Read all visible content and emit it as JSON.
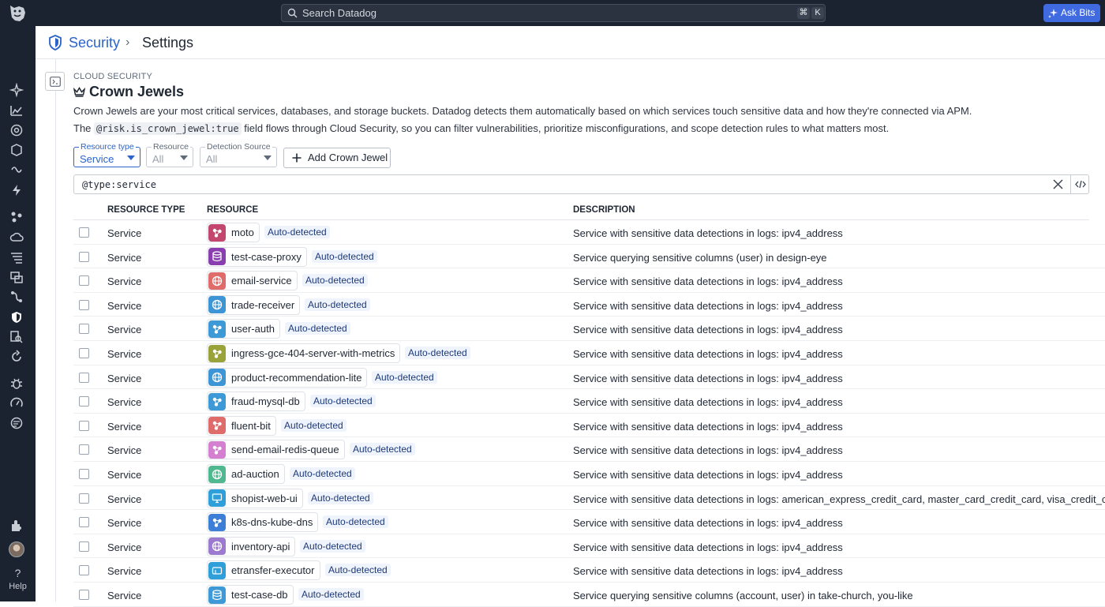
{
  "topbar": {
    "search_placeholder": "Search Datadog",
    "shortcut_cmd": "⌘",
    "shortcut_key": "K",
    "ask_bits_label": "Ask Bits"
  },
  "sidenav": {
    "help_label": "Help"
  },
  "breadcrumb": {
    "parent": "Security",
    "separator": "›",
    "current": "Settings"
  },
  "page": {
    "eyebrow": "CLOUD SECURITY",
    "title": "Crown Jewels",
    "desc_line1": "Crown Jewels are your most critical services, databases, and storage buckets. Datadog detects them automatically based on which services touch sensitive data and how they're connected via APM.",
    "desc_line2_prefix": "The",
    "desc_line2_code": "@risk.is_crown_jewel:true",
    "desc_line2_suffix": "field flows through Cloud Security, so you can filter vulnerabilities, prioritize misconfigurations, and scope detection rules to what matters most."
  },
  "filters": {
    "resource_type": {
      "label": "Resource type",
      "value": "Service"
    },
    "resource": {
      "label": "Resource",
      "value": "All"
    },
    "detection_source": {
      "label": "Detection Source",
      "value": "All"
    },
    "add_button": "Add Crown Jewel"
  },
  "query": {
    "key": "@type",
    "colon": ":",
    "value": "service"
  },
  "table": {
    "headers": {
      "type": "RESOURCE TYPE",
      "resource": "RESOURCE",
      "description": "DESCRIPTION"
    },
    "rows": [
      {
        "type": "Service",
        "name": "moto",
        "badge": "Auto-detected",
        "icon": "service-icon",
        "color": "#c2466e",
        "desc": "Service with sensitive data detections in logs: ipv4_address"
      },
      {
        "type": "Service",
        "name": "test-case-proxy",
        "badge": "Auto-detected",
        "icon": "database-icon",
        "color": "#8a3fb0",
        "desc": "Service querying sensitive columns (user) in design-eye"
      },
      {
        "type": "Service",
        "name": "email-service",
        "badge": "Auto-detected",
        "icon": "globe-icon",
        "color": "#e06b6b",
        "desc": "Service with sensitive data detections in logs: ipv4_address"
      },
      {
        "type": "Service",
        "name": "trade-receiver",
        "badge": "Auto-detected",
        "icon": "globe-icon",
        "color": "#3d95d6",
        "desc": "Service with sensitive data detections in logs: ipv4_address"
      },
      {
        "type": "Service",
        "name": "user-auth",
        "badge": "Auto-detected",
        "icon": "service-icon",
        "color": "#3d9ad6",
        "desc": "Service with sensitive data detections in logs: ipv4_address"
      },
      {
        "type": "Service",
        "name": "ingress-gce-404-server-with-metrics",
        "badge": "Auto-detected",
        "icon": "service-icon",
        "color": "#9aa33a",
        "desc": "Service with sensitive data detections in logs: ipv4_address"
      },
      {
        "type": "Service",
        "name": "product-recommendation-lite",
        "badge": "Auto-detected",
        "icon": "globe-icon",
        "color": "#3d95d6",
        "desc": "Service with sensitive data detections in logs: ipv4_address"
      },
      {
        "type": "Service",
        "name": "fraud-mysql-db",
        "badge": "Auto-detected",
        "icon": "service-icon",
        "color": "#3d9ad6",
        "desc": "Service with sensitive data detections in logs: ipv4_address"
      },
      {
        "type": "Service",
        "name": "fluent-bit",
        "badge": "Auto-detected",
        "icon": "service-icon",
        "color": "#e06b6b",
        "desc": "Service with sensitive data detections in logs: ipv4_address"
      },
      {
        "type": "Service",
        "name": "send-email-redis-queue",
        "badge": "Auto-detected",
        "icon": "service-icon",
        "color": "#d57fd1",
        "desc": "Service with sensitive data detections in logs: ipv4_address"
      },
      {
        "type": "Service",
        "name": "ad-auction",
        "badge": "Auto-detected",
        "icon": "globe-icon",
        "color": "#4fb88f",
        "desc": "Service with sensitive data detections in logs: ipv4_address"
      },
      {
        "type": "Service",
        "name": "shopist-web-ui",
        "badge": "Auto-detected",
        "icon": "monitor-icon",
        "color": "#2e9fd8",
        "desc": "Service with sensitive data detections in logs: american_express_credit_card, master_card_credit_card, visa_credit_card"
      },
      {
        "type": "Service",
        "name": "k8s-dns-kube-dns",
        "badge": "Auto-detected",
        "icon": "service-icon",
        "color": "#3d7fd6",
        "desc": "Service with sensitive data detections in logs: ipv4_address"
      },
      {
        "type": "Service",
        "name": "inventory-api",
        "badge": "Auto-detected",
        "icon": "globe-icon",
        "color": "#9b7ad0",
        "desc": "Service with sensitive data detections in logs: ipv4_address"
      },
      {
        "type": "Service",
        "name": "etransfer-executor",
        "badge": "Auto-detected",
        "icon": "window-icon",
        "color": "#2e9fd8",
        "desc": "Service with sensitive data detections in logs: ipv4_address"
      },
      {
        "type": "Service",
        "name": "test-case-db",
        "badge": "Auto-detected",
        "icon": "database-icon",
        "color": "#3d9ad6",
        "desc": "Service querying sensitive columns (account, user) in take-church, you-like"
      }
    ]
  }
}
